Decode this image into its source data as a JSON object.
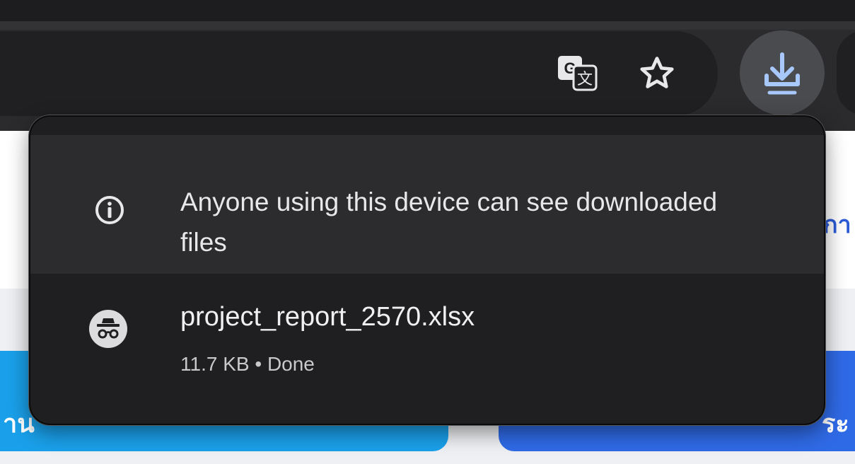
{
  "toolbar": {
    "icons": [
      "translate-icon",
      "star-icon",
      "download-icon"
    ]
  },
  "popup": {
    "notice": {
      "icon": "info-icon",
      "text": "Anyone using this device can see downloaded files"
    },
    "download_item": {
      "icon": "incognito-icon",
      "filename": "project_report_2570.xlsx",
      "size": "11.7 KB",
      "separator": "•",
      "status": "Done"
    }
  },
  "page": {
    "right_text_fragment": "กา",
    "left_card_text": "าน",
    "right_card_text": "ระ"
  },
  "colors": {
    "popup_bg": "#1f1f21",
    "notice_bg": "#2c2c2e",
    "download_accent": "#a8c7fa",
    "left_card": "#1aa0ea",
    "right_card": "#2f6ae6"
  }
}
